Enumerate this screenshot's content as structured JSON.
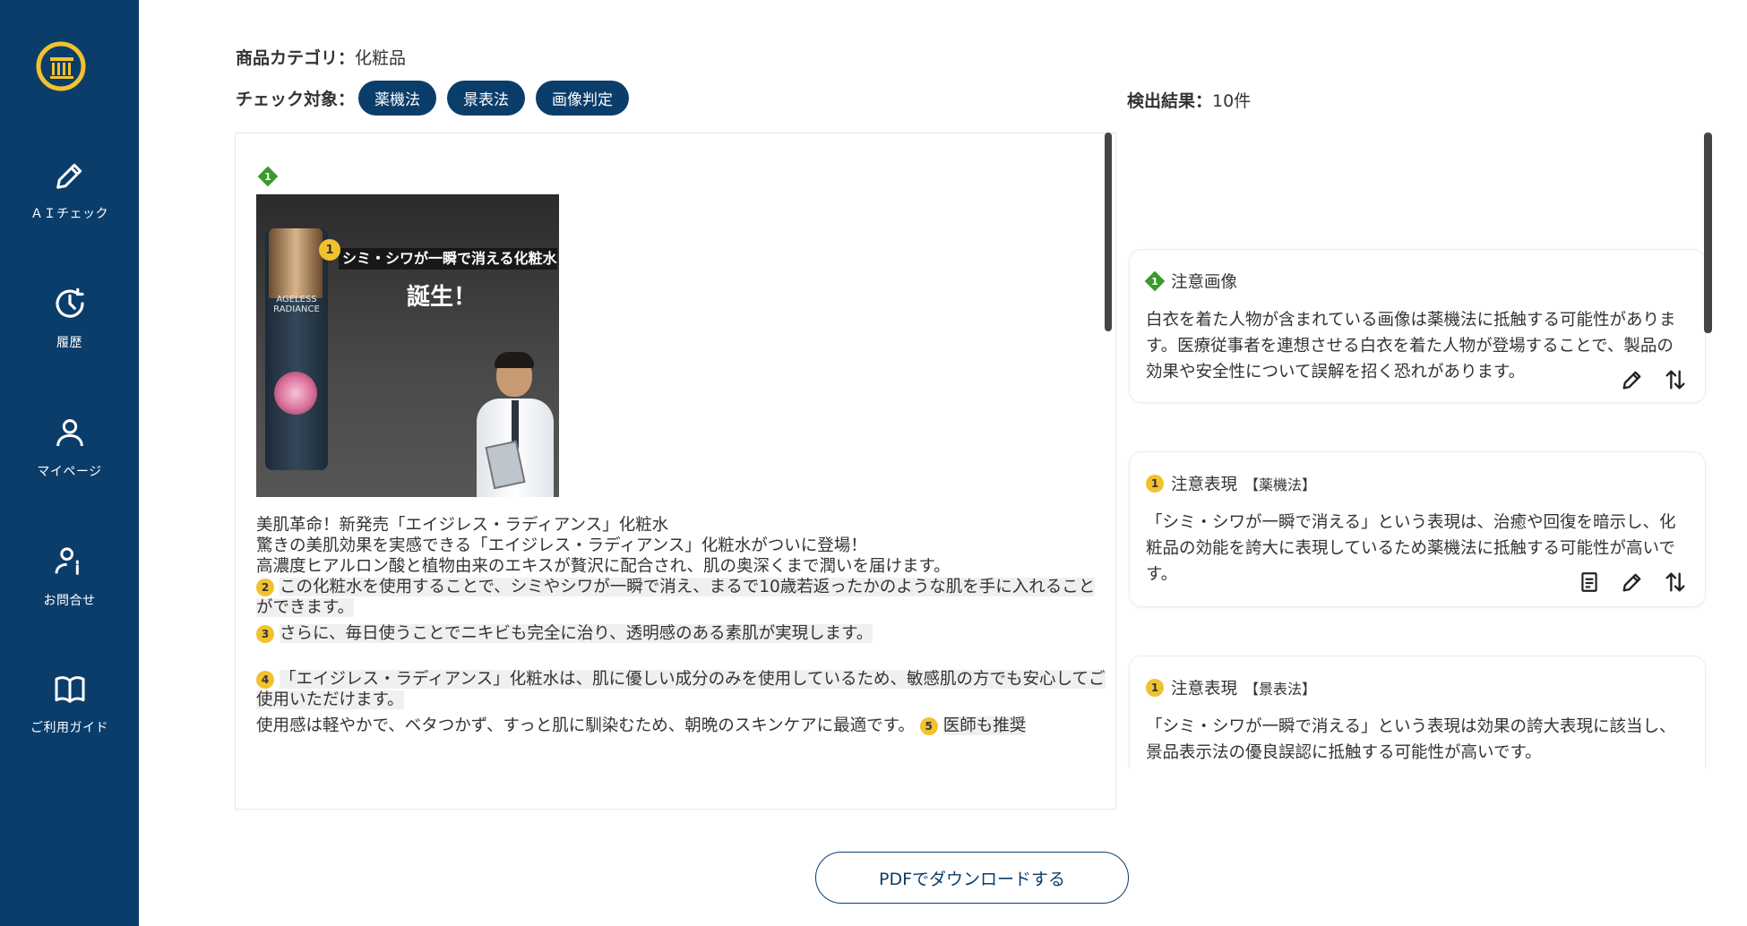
{
  "sidebar": {
    "logo_icon": "pillar-logo-icon",
    "items": [
      {
        "label": "ＡＩチェック",
        "icon": "pencil-icon"
      },
      {
        "label": "履歴",
        "icon": "clock-history-icon"
      },
      {
        "label": "マイページ",
        "icon": "user-icon"
      },
      {
        "label": "お問合せ",
        "icon": "user-info-icon"
      },
      {
        "label": "ご利用ガイド",
        "icon": "book-icon"
      }
    ]
  },
  "header": {
    "category_label": "商品カテゴリ：",
    "category_value": "化粧品",
    "targets_label": "チェック対象：",
    "targets": [
      "薬機法",
      "景表法",
      "画像判定"
    ],
    "results_label": "検出結果：",
    "results_value": "10件"
  },
  "document": {
    "image_marker": "1",
    "image": {
      "badge": "1",
      "promo_line": "シミ・シワが一瞬で消える化粧水",
      "promo_big": "誕生！",
      "bottle_label": "AGELESS RADIANCE"
    },
    "line1": "美肌革命！新発売「エイジレス・ラディアンス」化粧水",
    "line2": "驚きの美肌効果を実感できる「エイジレス・ラディアンス」化粧水がついに登場！",
    "line3": "高濃度ヒアルロン酸と植物由来のエキスが贅沢に配合され、肌の奥深くまで潤いを届けます。",
    "para2_badge": "2",
    "para2": "この化粧水を使用することで、シミやシワが一瞬で消え、まるで10歳若返ったかのような肌を手に入れることができます。",
    "para3_badge": "3",
    "para3": "さらに、毎日使うことでニキビも完全に治り、透明感のある素肌が実現します。",
    "para4_badge": "4",
    "para4": "「エイジレス・ラディアンス」化粧水は、肌に優しい成分のみを使用しているため、敏感肌の方でも安心してご使用いただけます。",
    "para5_text": "使用感は軽やかで、ベタつかず、すっと肌に馴染むため、朝晩のスキンケアに最適です。",
    "para5_badge": "5",
    "para5_tail": "医師も推奨"
  },
  "cards": [
    {
      "marker": "1",
      "title": "注意画像",
      "law": "",
      "body": "白衣を着た人物が含まれている画像は薬機法に抵触する可能性があります。医療従事者を連想させる白衣を着た人物が登場することで、製品の効果や安全性について誤解を招く恐れがあります。"
    },
    {
      "marker": "1",
      "title": "注意表現",
      "law": "【薬機法】",
      "body": "「シミ・シワが一瞬で消える」という表現は、治癒や回復を暗示し、化粧品の効能を誇大に表現しているため薬機法に抵触する可能性が高いです。"
    },
    {
      "marker": "1",
      "title": "注意表現",
      "law": "【景表法】",
      "body": "「シミ・シワが一瞬で消える」という表現は効果の誇大表現に該当し、景品表示法の優良誤認に抵触する可能性が高いです。"
    }
  ],
  "download_button": "PDFでダウンロードする",
  "colors": {
    "brand": "#0b3d6b",
    "marker_green": "#3a9a2c",
    "badge_yellow": "#f2c22e"
  }
}
